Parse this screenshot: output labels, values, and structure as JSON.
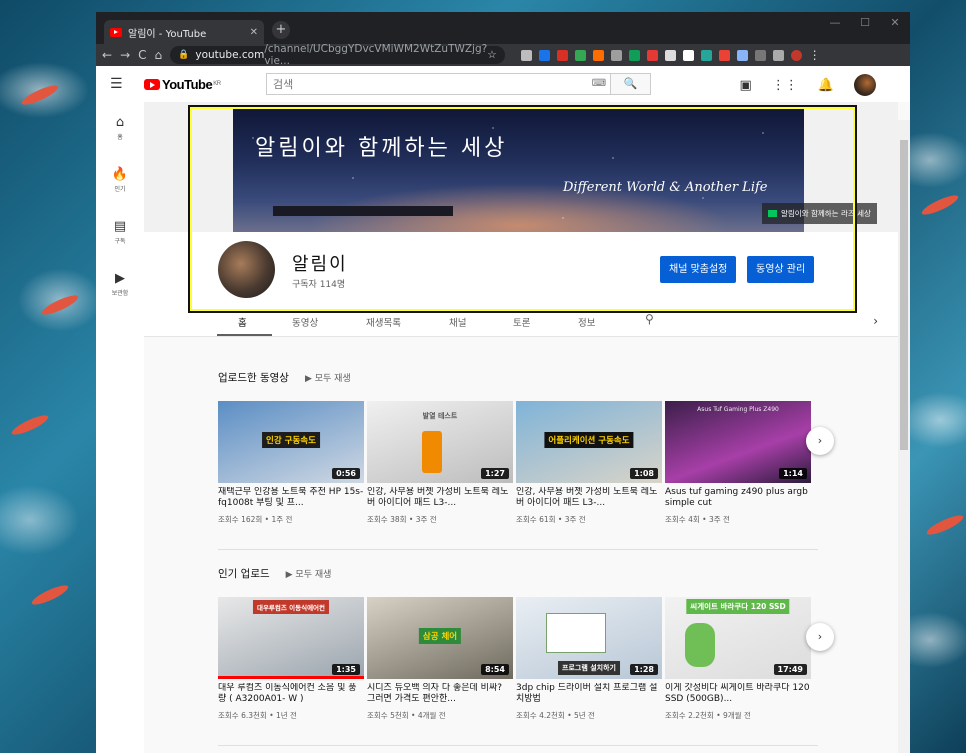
{
  "browser": {
    "tab_title": "알림이 - YouTube",
    "tab_close": "✕",
    "new_tab": "+",
    "url_domain": "youtube.com",
    "url_path": "/channel/UCbggYDvcVMiWM2WtZuTWZjg?vie...",
    "window_controls": [
      "—",
      "☐",
      "✕"
    ]
  },
  "masthead": {
    "logo_text": "YouTube",
    "region": "KR",
    "search_placeholder": "검색",
    "keyboard_icon": "⌨",
    "search_icon": "🔍"
  },
  "guide": [
    {
      "icon": "home-icon",
      "glyph": "⌂",
      "label": "홈"
    },
    {
      "icon": "fire-icon",
      "glyph": "🔥",
      "label": "인기"
    },
    {
      "icon": "subscriptions-icon",
      "glyph": "▤",
      "label": "구독"
    },
    {
      "icon": "library-icon",
      "glyph": "▶",
      "label": "보관함"
    }
  ],
  "banner": {
    "title": "알림이와 함께하는 세상",
    "subtitle": "Different World & Another Life",
    "link_text": "알림이와 함께하는 라즈 세상"
  },
  "channel": {
    "name": "알림이",
    "subscribers": "구독자 114명",
    "customize_button": "채널 맞춤설정",
    "manage_button": "동영상 관리"
  },
  "tabs": [
    "홈",
    "동영상",
    "재생목록",
    "채널",
    "토론",
    "정보"
  ],
  "shelves": [
    {
      "title": "업로드한 동영상",
      "play_all": "▶  모두 재생",
      "videos": [
        {
          "title": "재택근무 인강용 노트북 추천 HP 15s-fq1008t 부팅 및 프...",
          "meta": "조회수 162회 • 1주 전",
          "duration": "0:56",
          "thumb_label": "인강 구동속도",
          "thumb_colors": [
            "#5b8ec4",
            "#cfd8e3"
          ]
        },
        {
          "title": "인강, 사무용 버젯 가성비 노트북 레노버 아이디어 패드 L3-...",
          "meta": "조회수 38회 • 3주 전",
          "duration": "1:27",
          "thumb_label": "발열 테스트",
          "thumb_colors": [
            "#e9e9e9",
            "#bdbdbd"
          ]
        },
        {
          "title": "인강, 사무용 버젯 가성비 노트북 레노버 아이디어 패드 L3-...",
          "meta": "조회수 61회 • 3주 전",
          "duration": "1:08",
          "thumb_label": "어플리케이션 구동속도",
          "thumb_colors": [
            "#7fb3d8",
            "#d9d4c8"
          ]
        },
        {
          "title": "Asus tuf gaming z490 plus argb simple cut",
          "meta": "조회수 4회 • 3주 전",
          "duration": "1:14",
          "thumb_label": "Asus Tuf Gaming Plus Z490",
          "thumb_colors": [
            "#3b1f4a",
            "#a73fa8"
          ]
        }
      ]
    },
    {
      "title": "인기 업로드",
      "play_all": "▶  모두 재생",
      "videos": [
        {
          "title": "대우 루컴즈 이동식에어컨 소음 및 풍량 ( A3200A01- W )",
          "meta": "조회수 6.3천회 • 1년 전",
          "duration": "1:35",
          "thumb_label": "대우루컴즈 이동식에어컨",
          "thumb_colors": [
            "#e8e8e8",
            "#9aa4ad"
          ]
        },
        {
          "title": "시디즈 듀오백 의자 다 좋은데 비싸? 그러면 가격도 편안한...",
          "meta": "조회수 5천회 • 4개월 전",
          "duration": "8:54",
          "thumb_label": "삼공 체어",
          "thumb_colors": [
            "#d7d2c5",
            "#6f6a5e"
          ]
        },
        {
          "title": "3dp chip 드라이버 설치 프로그램 설치방법",
          "meta": "조회수 4.2천회 • 5년 전",
          "duration": "1:28",
          "thumb_label": "프로그램 설치하기",
          "thumb_colors": [
            "#e9eef3",
            "#7aa06b"
          ]
        },
        {
          "title": "이게 갓성비다 씨게이트 바라쿠다 120 SSD (500GB)...",
          "meta": "조회수 2.2천회 • 9개월 전",
          "duration": "17:49",
          "thumb_label": "씨게이트 바라쿠다 120 SSD",
          "thumb_colors": [
            "#6fbf56",
            "#e8e8e8"
          ]
        }
      ]
    }
  ],
  "colors": {
    "accent": "#065fd4",
    "brand": "#ff0000",
    "highlight": "#ffff33"
  }
}
